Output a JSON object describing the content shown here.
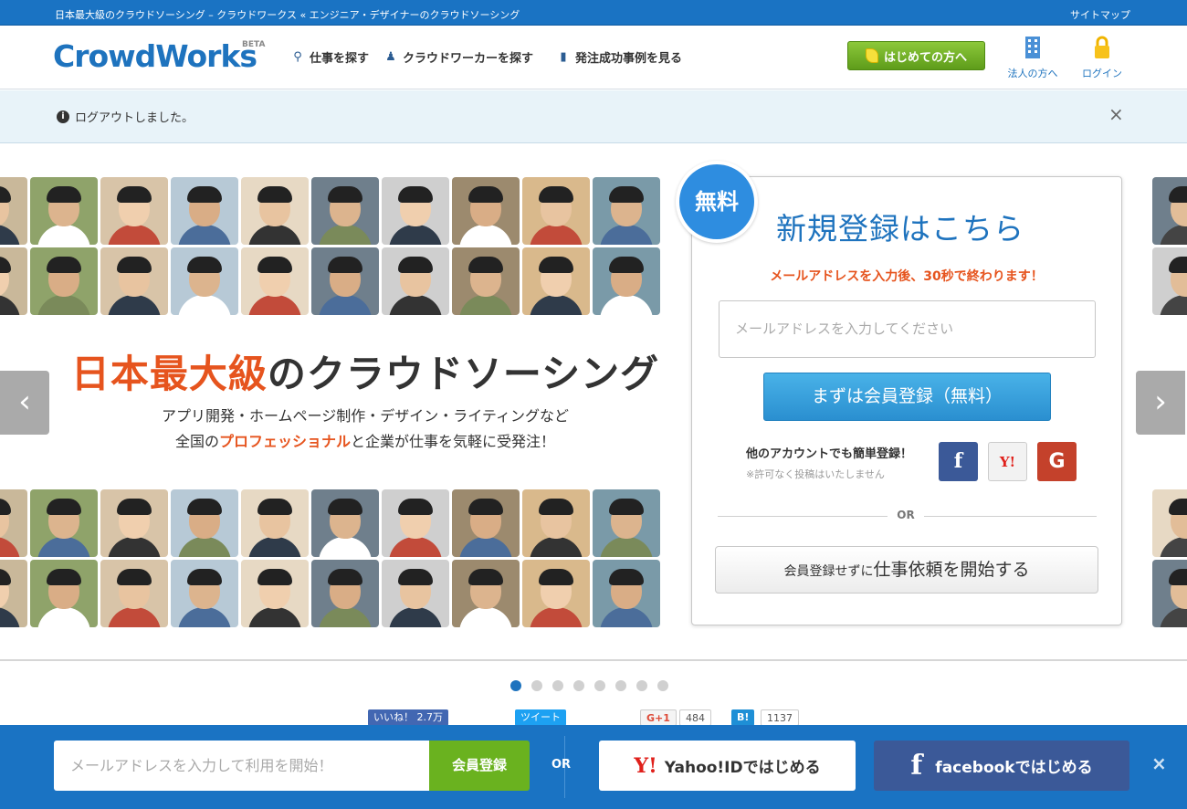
{
  "topbar": {
    "tagline": "日本最大級のクラウドソーシング – クラウドワークス « エンジニア・デザイナーのクラウドソーシング",
    "sitemap": "サイトマップ"
  },
  "header": {
    "logo": "CrowdWorks",
    "beta": "BETA",
    "nav": [
      "仕事を探す",
      "クラウドワーカーを探す",
      "発注成功事例を見る"
    ],
    "first_time": "はじめての方へ",
    "corporate": "法人の方へ",
    "login": "ログイン"
  },
  "notice": {
    "message": "ログアウトしました。",
    "close": "×"
  },
  "hero": {
    "title_accent": "日本最大級",
    "title_rest": "のクラウドソーシング",
    "sub_line1": "アプリ開発・ホームページ制作・デザイン・ライティングなど",
    "sub_line2_a": "全国の",
    "sub_line2_accent": "プロフェッショナル",
    "sub_line2_b": "と企業が仕事を気軽に受発注！",
    "prev": "‹",
    "next": "›"
  },
  "register": {
    "badge": "無料",
    "title": "新規登録はこちら",
    "note": "メールアドレスを入力後、30秒で終わります！",
    "email_placeholder": "メールアドレスを入力してください",
    "submit": "まずは会員登録（無料）",
    "other_label": "他のアカウントでも簡単登録！",
    "other_note": "※許可なく投稿はいたしません",
    "facebook": "f",
    "yahoo": "Y!",
    "google": "G",
    "or": "OR",
    "noreg_small": "会員登録せずに",
    "noreg_big": "仕事依頼を開始する"
  },
  "share": {
    "like": "いいね！ 2.7万",
    "tweet": "ツイート",
    "gplus": "G+1",
    "gplus_count": "484",
    "hatena": "B!",
    "hatena_count": "1137"
  },
  "bottombar": {
    "placeholder": "メールアドレスを入力して利用を開始！",
    "join": "会員登録",
    "or": "OR",
    "yahoo_logo": "Y!",
    "yahoo": "Yahoo!IDではじめる",
    "facebook_logo": "f",
    "facebook": "facebookではじめる",
    "close": "×"
  },
  "colors": {
    "brand_blue": "#1e73be",
    "accent_orange": "#e6541e",
    "green": "#6ab21f"
  }
}
